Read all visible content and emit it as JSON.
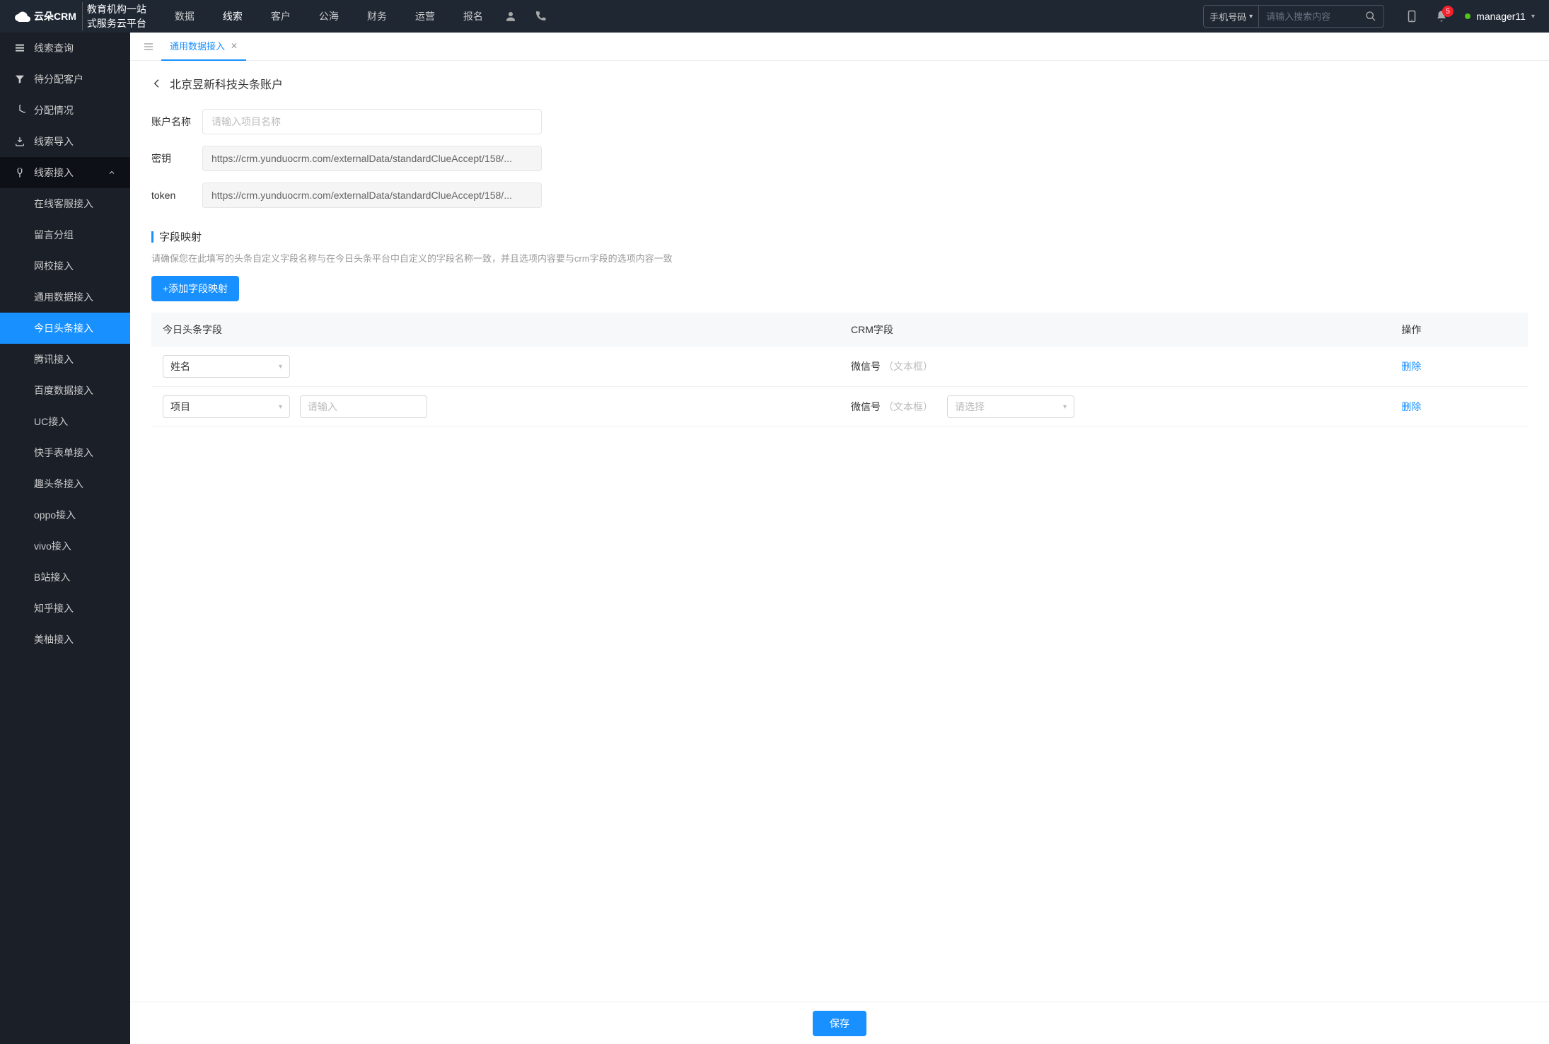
{
  "header": {
    "logo_main": "云朵CRM",
    "logo_sub1": "教育机构一站",
    "logo_sub2": "式服务云平台",
    "nav": [
      "数据",
      "线索",
      "客户",
      "公海",
      "财务",
      "运营",
      "报名"
    ],
    "nav_active_index": 1,
    "search_select": "手机号码",
    "search_placeholder": "请输入搜索内容",
    "notif_count": "5",
    "username": "manager11"
  },
  "sidebar": {
    "items": [
      {
        "label": "线索查询",
        "icon": "list"
      },
      {
        "label": "待分配客户",
        "icon": "filter"
      },
      {
        "label": "分配情况",
        "icon": "chart"
      },
      {
        "label": "线索导入",
        "icon": "import"
      },
      {
        "label": "线索接入",
        "icon": "plug",
        "open": true,
        "children": [
          "在线客服接入",
          "留言分组",
          "网校接入",
          "通用数据接入",
          "今日头条接入",
          "腾讯接入",
          "百度数据接入",
          "UC接入",
          "快手表单接入",
          "趣头条接入",
          "oppo接入",
          "vivo接入",
          "B站接入",
          "知乎接入",
          "美柚接入"
        ],
        "active_child": 4
      }
    ]
  },
  "tabs": [
    {
      "label": "通用数据接入",
      "active": true
    }
  ],
  "page": {
    "title": "北京昱新科技头条账户",
    "fields": {
      "account_name_label": "账户名称",
      "account_name_placeholder": "请输入项目名称",
      "secret_label": "密钥",
      "secret_value": "https://crm.yunduocrm.com/externalData/standardClueAccept/158/...",
      "token_label": "token",
      "token_value": "https://crm.yunduocrm.com/externalData/standardClueAccept/158/..."
    },
    "mapping": {
      "title": "字段映射",
      "desc": "请确保您在此填写的头条自定义字段名称与在今日头条平台中自定义的字段名称一致，并且选项内容要与crm字段的选项内容一致",
      "add_btn": "+添加字段映射",
      "columns": {
        "source": "今日头条字段",
        "crm": "CRM字段",
        "op": "操作"
      },
      "rows": [
        {
          "source_value": "姓名",
          "crm_name": "微信号",
          "crm_type": "（文本框）",
          "has_select": false,
          "op": "删除"
        },
        {
          "source_value": "项目",
          "extra_input_placeholder": "请输入",
          "crm_name": "微信号",
          "crm_type": "（文本框）",
          "has_select": true,
          "select_placeholder": "请选择",
          "op": "删除"
        }
      ]
    },
    "save_btn": "保存"
  }
}
